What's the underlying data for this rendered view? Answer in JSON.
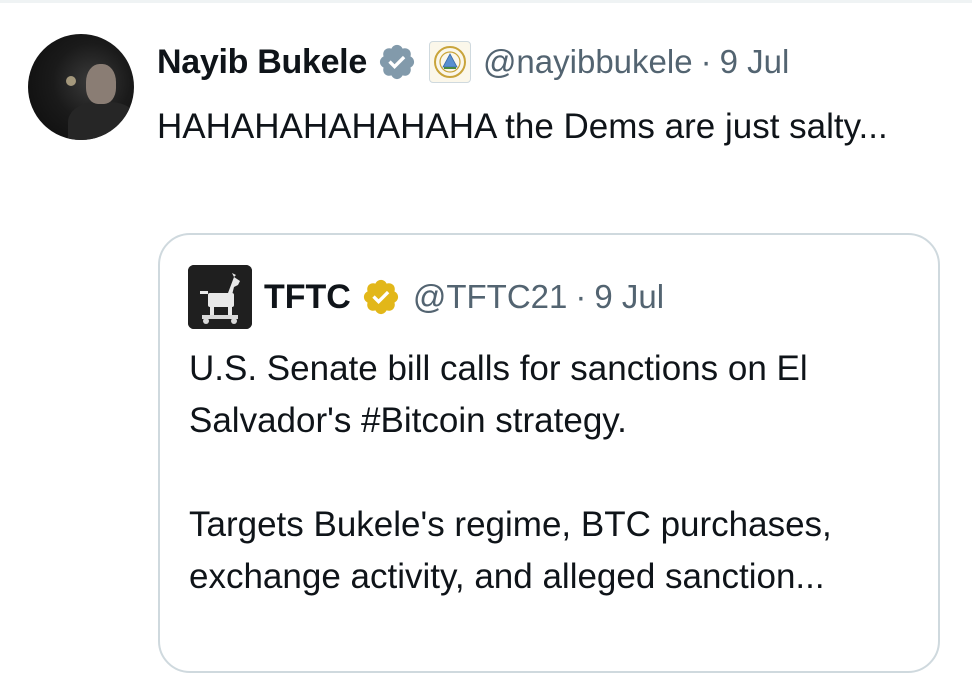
{
  "tweet": {
    "author_name": "Nayib Bukele",
    "handle": "@nayibbukele",
    "separator": "·",
    "date": "9 Jul",
    "text": "HAHAHAHAHAHAHA the Dems are just salty...",
    "verified_color": "#829aab",
    "avatar_icon": "person-photo"
  },
  "quoted_tweet": {
    "author_name": "TFTC",
    "handle": "@TFTC21",
    "separator": "·",
    "date": "9 Jul",
    "paragraph_1": "U.S. Senate bill calls for sanctions on El Salvador's #Bitcoin strategy.",
    "paragraph_2": "Targets Bukele's regime, BTC purchases, exchange activity, and alleged sanction...",
    "verified_color": "#e2b719",
    "avatar_icon": "trojan-horse-logo"
  },
  "colors": {
    "text_primary": "#0f1419",
    "text_secondary": "#536471",
    "border": "#cfd9de"
  }
}
